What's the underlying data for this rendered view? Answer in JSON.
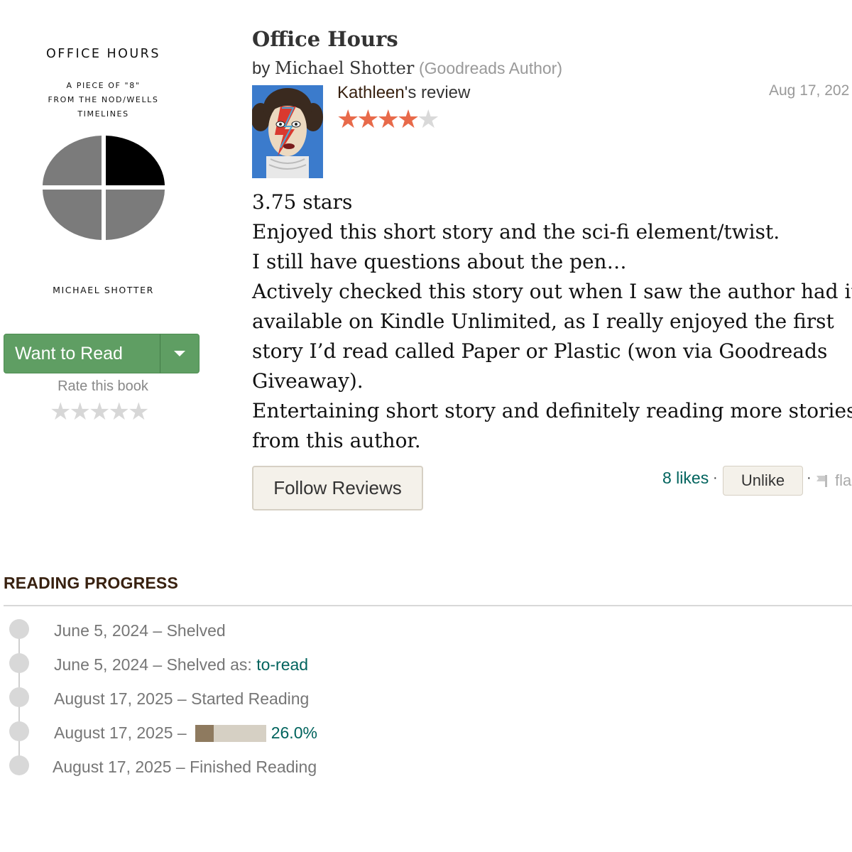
{
  "cover": {
    "title": "OFFICE HOURS",
    "subtitle": "A PIECE OF \"8\"\nFROM THE NOD/WELLS\nTIMELINES",
    "author": "MICHAEL SHOTTER"
  },
  "shelf": {
    "want_to_read_label": "Want to Read",
    "rate_label": "Rate this book",
    "rate_stars": [
      "★",
      "★",
      "★",
      "★",
      "★"
    ]
  },
  "book": {
    "title": "Office Hours",
    "by_label": "by",
    "author": "Michael Shotter",
    "author_badge": "(Goodreads Author)"
  },
  "review": {
    "reviewer": "Kathleen",
    "review_suffix": "'s review",
    "date": "Aug 17, 202",
    "rating": 4,
    "rating_max": 5,
    "lines": [
      "3.75 stars",
      "Enjoyed this short story and the sci-fi element/twist.",
      "I still have questions about the pen…",
      "Actively checked this story out when I saw the author had it",
      "available on Kindle Unlimited, as I really enjoyed the first",
      "story I’d read called Paper or Plastic (won via Goodreads",
      "Giveaway).",
      "Entertaining short story and definitely reading more stories",
      "from this author."
    ]
  },
  "actions": {
    "follow_label": "Follow Reviews",
    "likes_label": "8 likes",
    "separator": "·",
    "unlike_label": "Unlike",
    "flag_label": "fla"
  },
  "reading_progress": {
    "heading": "READING PROGRESS",
    "entries": [
      {
        "date": "June 5, 2024",
        "sep": "–",
        "text": "Shelved"
      },
      {
        "date": "June 5, 2024",
        "sep": "–",
        "text": "Shelved as:",
        "link": "to-read"
      },
      {
        "date": "August 17, 2025",
        "sep": "–",
        "text": "Started Reading"
      },
      {
        "date": "August 17, 2025",
        "sep": "–",
        "progress": 0.26,
        "progress_label": "26.0%"
      },
      {
        "date": "August 17, 2025",
        "sep": "–",
        "text": "Finished Reading"
      }
    ]
  },
  "colors": {
    "button_green": "#5f9e63",
    "star_orange": "#e86a4a",
    "link_teal": "#00635d",
    "heading_brown": "#382110",
    "progress_fill": "#8e7a5f"
  },
  "icons": {
    "dropdown": "caret-down-icon",
    "flag": "flag-icon",
    "star": "star-icon"
  }
}
